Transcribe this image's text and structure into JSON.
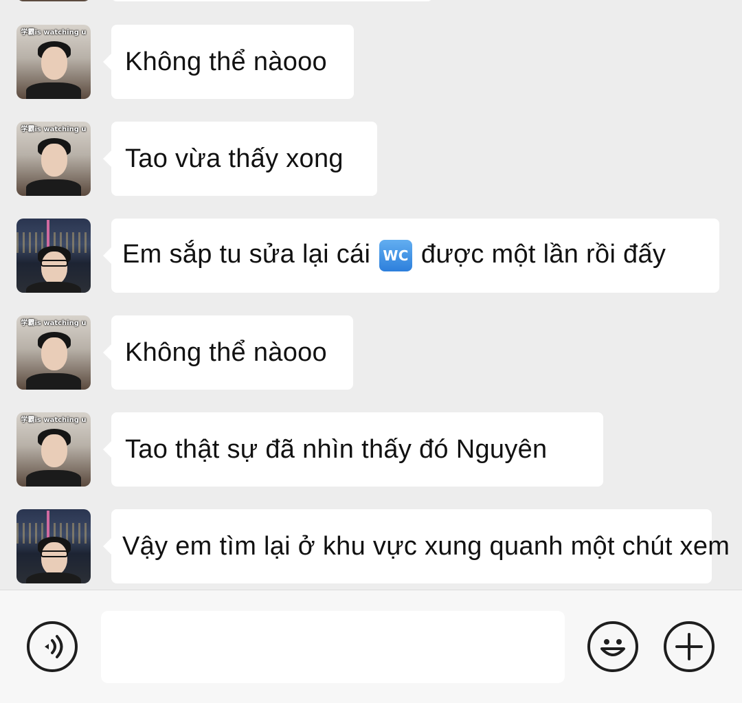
{
  "avatars": {
    "friend": {
      "caption": "学霸is watching u"
    },
    "me": {
      "caption": ""
    }
  },
  "messages": [
    {
      "sender": "friend",
      "text": "Không thể nàooo"
    },
    {
      "sender": "friend",
      "text": "Tao vừa thấy xong"
    },
    {
      "sender": "me",
      "text_before": "Em sắp tu sửa lại cái ",
      "emoji": "WC",
      "text_after": " được một lần rồi đấy"
    },
    {
      "sender": "friend",
      "text": "Không thể nàooo"
    },
    {
      "sender": "friend",
      "text": "Tao thật sự đã nhìn thấy đó Nguyên"
    },
    {
      "sender": "me",
      "text": "Vậy em tìm lại ở khu vực xung quanh một chút xem"
    }
  ],
  "input_bar": {
    "voice_icon": "voice-icon",
    "text_value": "",
    "emoji_icon": "smiley-icon",
    "plus_icon": "plus-icon"
  },
  "colors": {
    "background": "#ededed",
    "bubble": "#ffffff",
    "input_bar": "#f7f7f7"
  }
}
